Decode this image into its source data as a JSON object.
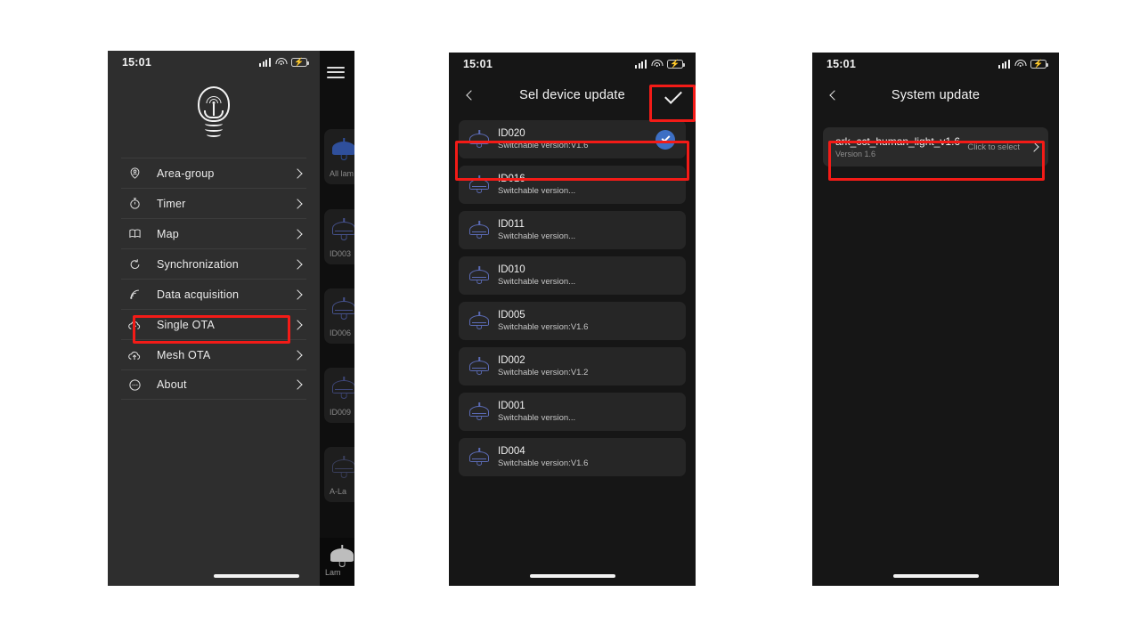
{
  "common": {
    "status": {
      "time": "15:01",
      "signal_icon": "signal-bars-icon",
      "wifi_icon": "wifi-icon",
      "battery_icon": "battery-charging-icon"
    }
  },
  "phone1": {
    "logo_icon": "smart-bulb-logo-icon",
    "menu": [
      {
        "label": "Area-group",
        "icon": "area-group-icon",
        "highlighted": false
      },
      {
        "label": "Timer",
        "icon": "timer-icon",
        "highlighted": false
      },
      {
        "label": "Map",
        "icon": "map-icon",
        "highlighted": false
      },
      {
        "label": "Synchronization",
        "icon": "sync-icon",
        "highlighted": false
      },
      {
        "label": "Data acquisition",
        "icon": "data-acquisition-icon",
        "highlighted": false
      },
      {
        "label": "Single OTA",
        "icon": "cloud-upload-icon",
        "highlighted": true
      },
      {
        "label": "Mesh OTA",
        "icon": "cloud-upload-icon",
        "highlighted": false
      },
      {
        "label": "About",
        "icon": "about-icon",
        "highlighted": false
      }
    ],
    "background_strip": {
      "menu_icon": "hamburger-menu-icon",
      "cards": [
        {
          "label": "All lam"
        },
        {
          "label": "ID003"
        },
        {
          "label": "ID006"
        },
        {
          "label": "ID009"
        },
        {
          "label": "A-La"
        }
      ],
      "bottom_card": {
        "label": "Lam"
      }
    }
  },
  "phone2": {
    "nav": {
      "back_icon": "back-chevron-icon",
      "title": "Sel device update",
      "confirm_icon": "checkmark-icon"
    },
    "devices": [
      {
        "name": "ID020",
        "sub": "Switchable version:V1.6",
        "selected": true
      },
      {
        "name": "ID016",
        "sub": "Switchable version...",
        "selected": false
      },
      {
        "name": "ID011",
        "sub": "Switchable version...",
        "selected": false
      },
      {
        "name": "ID010",
        "sub": "Switchable version...",
        "selected": false
      },
      {
        "name": "ID005",
        "sub": "Switchable version:V1.6",
        "selected": false
      },
      {
        "name": "ID002",
        "sub": "Switchable version:V1.2",
        "selected": false
      },
      {
        "name": "ID001",
        "sub": "Switchable version...",
        "selected": false
      },
      {
        "name": "ID004",
        "sub": "Switchable version:V1.6",
        "selected": false
      }
    ]
  },
  "phone3": {
    "nav": {
      "back_icon": "back-chevron-icon",
      "title": "System update"
    },
    "firmware": {
      "file_name": "ark_cct_human_light_v1.6",
      "version": "Version 1.6",
      "action_hint": "Click to select",
      "arrow_icon": "chevron-right-icon"
    }
  },
  "colors": {
    "annotation": "#f31b17",
    "accent_blue": "#3d6fc4",
    "lamp_icon": "#5b6bb5",
    "battery_green": "#36c94a"
  }
}
